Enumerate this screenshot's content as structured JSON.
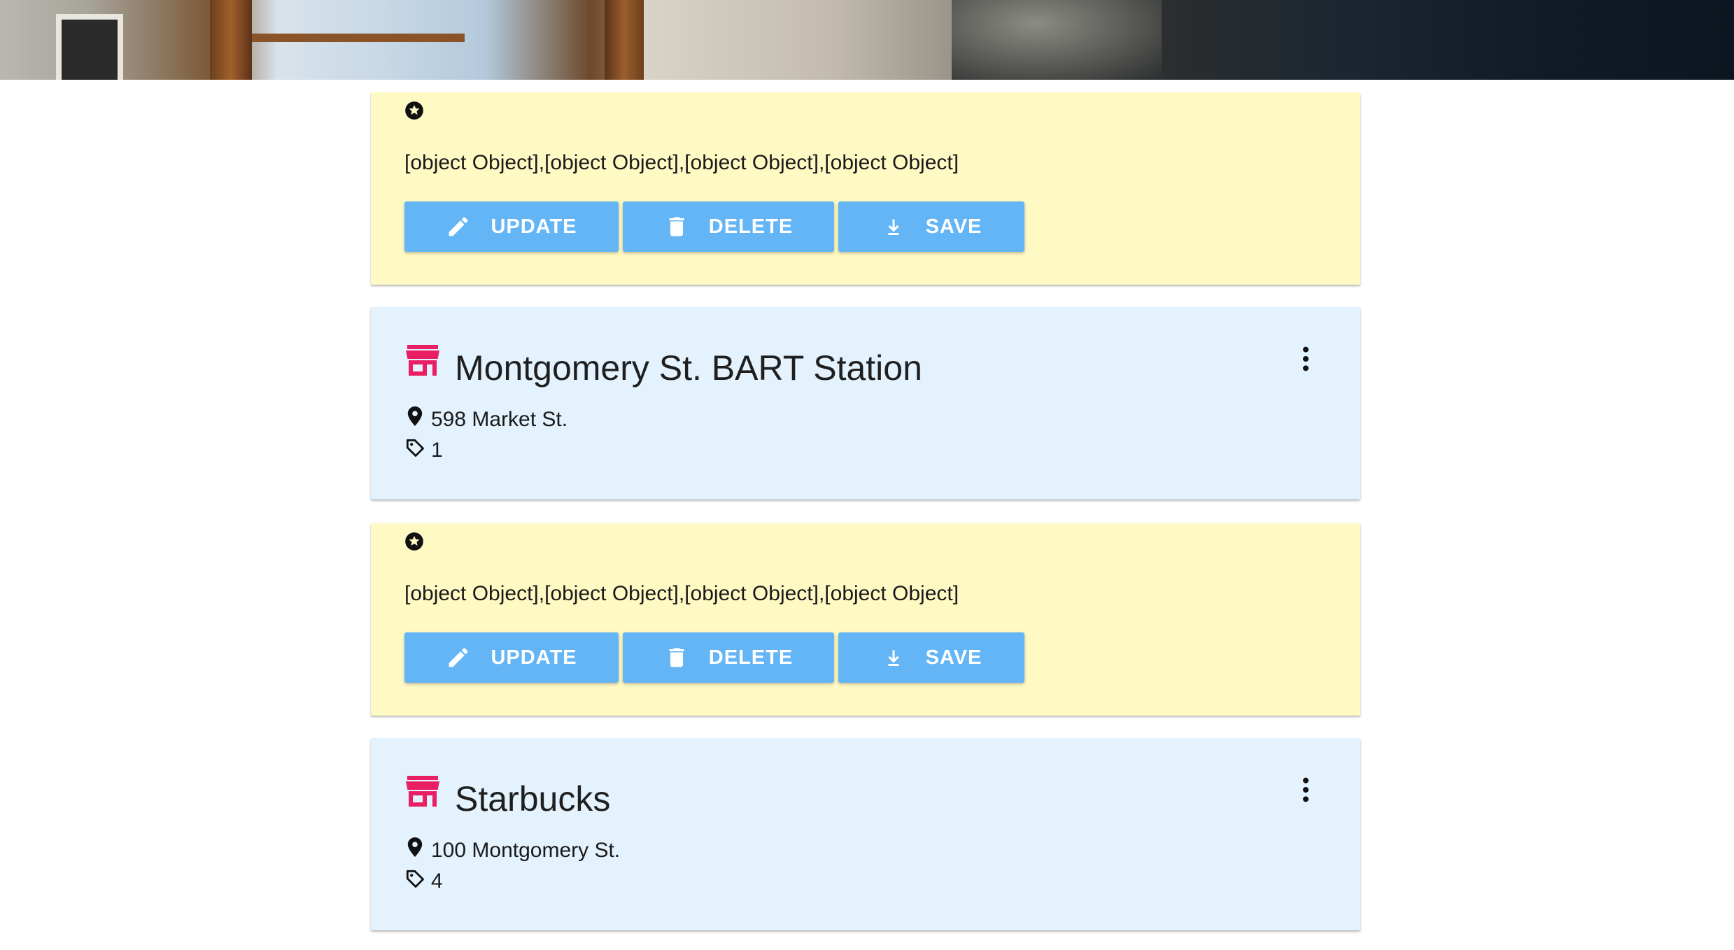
{
  "colors": {
    "yellow_card": "#fff9c4",
    "blue_card": "#e3f2fd",
    "button": "#64b5f6",
    "store_icon": "#e91e63"
  },
  "feed": {
    "actions": [
      {
        "icon": "star-circle-icon",
        "text": "[object Object],[object Object],[object Object],[object Object]",
        "buttons": {
          "update": {
            "label": "UPDATE",
            "icon": "pencil-icon"
          },
          "delete": {
            "label": "DELETE",
            "icon": "trash-icon"
          },
          "save": {
            "label": "SAVE",
            "icon": "download-icon"
          }
        }
      },
      {
        "icon": "star-circle-icon",
        "text": "[object Object],[object Object],[object Object],[object Object]",
        "buttons": {
          "update": {
            "label": "UPDATE",
            "icon": "pencil-icon"
          },
          "delete": {
            "label": "DELETE",
            "icon": "trash-icon"
          },
          "save": {
            "label": "SAVE",
            "icon": "download-icon"
          }
        }
      }
    ],
    "places": [
      {
        "icon": "store-icon",
        "name": "Montgomery St. BART Station",
        "address": "598 Market St.",
        "tag_count": "1"
      },
      {
        "icon": "store-icon",
        "name": "Starbucks",
        "address": "100 Montgomery St.",
        "tag_count": "4"
      }
    ]
  }
}
